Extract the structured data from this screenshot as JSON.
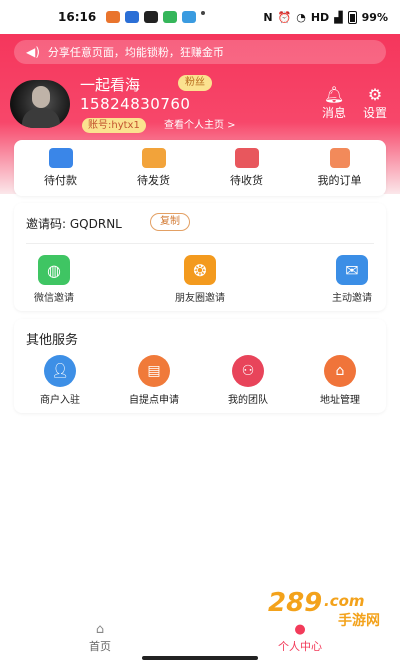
{
  "status_bar": {
    "time": "16:16",
    "battery": "99%",
    "indicators": [
      "N",
      "alarm",
      "wifi",
      "HD",
      "signal",
      "battery"
    ]
  },
  "notice": {
    "icon": "speaker-icon",
    "text": "分享任意页面，均能锁粉，狂赚金币"
  },
  "profile": {
    "name": "一起看海",
    "badge": "粉丝",
    "phone": "15824830760",
    "account": "账号:hytx1",
    "homepage_link": "查看个人主页 >"
  },
  "header_actions": {
    "messages": {
      "label": "消息",
      "icon": "bell-icon"
    },
    "settings": {
      "label": "设置",
      "icon": "gear-icon"
    }
  },
  "orders": [
    {
      "label": "待付款",
      "icon": "wallet-icon",
      "color": "#3a86e8"
    },
    {
      "label": "待发货",
      "icon": "truck-icon",
      "color": "#f2a33a"
    },
    {
      "label": "待收货",
      "icon": "box-icon",
      "color": "#e8575d"
    },
    {
      "label": "我的订单",
      "icon": "order-list-icon",
      "color": "#f28a5a"
    }
  ],
  "invite": {
    "code_label": "邀请码:",
    "code": "GQDRNL",
    "copy_label": "复制",
    "items": [
      {
        "label": "微信邀请",
        "icon": "wechat-icon",
        "color": "#3fc563"
      },
      {
        "label": "朋友圈邀请",
        "icon": "aperture-icon",
        "color": "#f39a1e"
      },
      {
        "label": "主动邀请",
        "icon": "mail-icon",
        "color": "#3b8ee6"
      }
    ]
  },
  "services": {
    "title": "其他服务",
    "items": [
      {
        "label": "商户入驻",
        "icon": "merchant-icon",
        "color": "#3d8fe6"
      },
      {
        "label": "自提点申请",
        "icon": "store-icon",
        "color": "#f07a3a"
      },
      {
        "label": "我的团队",
        "icon": "team-icon",
        "color": "#e8445a"
      },
      {
        "label": "地址管理",
        "icon": "address-icon",
        "color": "#f0743a"
      }
    ]
  },
  "tabbar": {
    "items": [
      {
        "label": "首页",
        "icon": "home-icon",
        "active": false
      },
      {
        "label": "个人中心",
        "icon": "person-icon",
        "active": true
      }
    ]
  },
  "watermark": {
    "number": "289",
    "domain": ".com",
    "text": "手游网"
  },
  "colors": {
    "accent": "#f23b5a",
    "badge_bg": "#fbe28f"
  }
}
